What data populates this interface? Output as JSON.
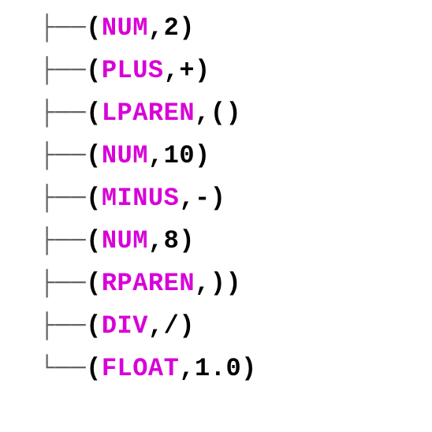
{
  "tokens": [
    {
      "branch": "├──",
      "type": "NUM",
      "value": "2"
    },
    {
      "branch": "├──",
      "type": "PLUS",
      "value": "+"
    },
    {
      "branch": "├──",
      "type": "LPAREN",
      "value": "("
    },
    {
      "branch": "├──",
      "type": "NUM",
      "value": "10"
    },
    {
      "branch": "├──",
      "type": "MINUS",
      "value": "-"
    },
    {
      "branch": "├──",
      "type": "NUM",
      "value": "8"
    },
    {
      "branch": "├──",
      "type": "RPAREN",
      "value": ")"
    },
    {
      "branch": "├──",
      "type": "DIV",
      "value": "/"
    },
    {
      "branch": "└──",
      "type": "FLOAT",
      "value": "1.0"
    }
  ]
}
